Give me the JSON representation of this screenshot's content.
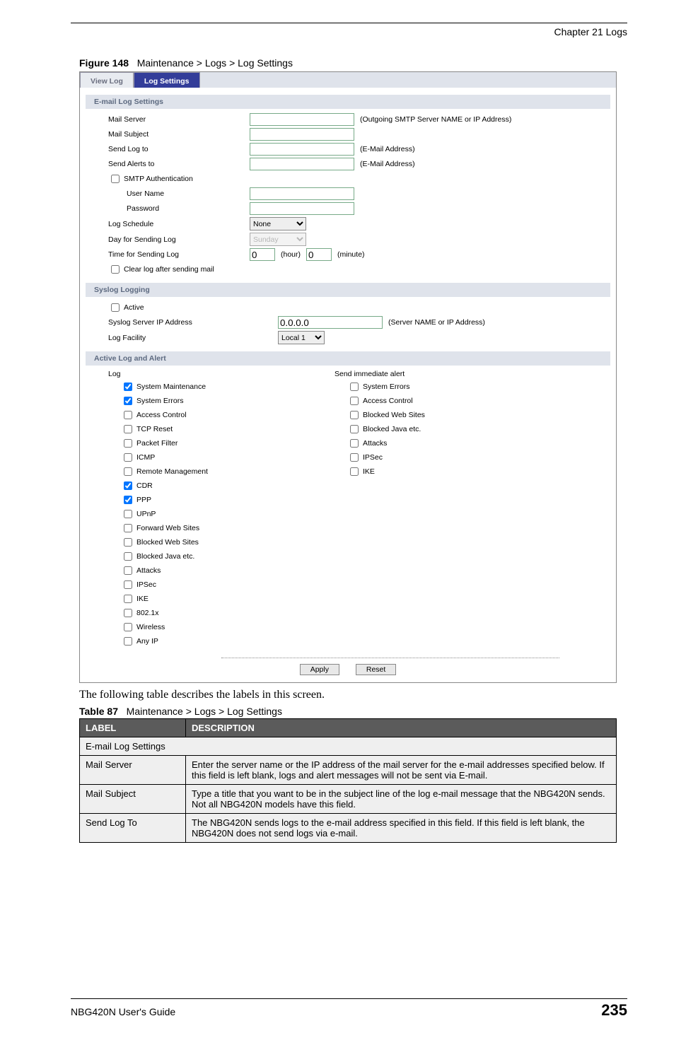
{
  "doc": {
    "chapter_header": "Chapter 21 Logs",
    "footer_guide": "NBG420N User's Guide",
    "page_number": "235"
  },
  "figure": {
    "caption_prefix": "Figure 148",
    "caption_text": "Maintenance > Logs > Log Settings"
  },
  "tabs": {
    "view_log": "View Log",
    "log_settings": "Log Settings"
  },
  "sections": {
    "email": "E-mail Log Settings",
    "syslog": "Syslog Logging",
    "active": "Active Log and Alert"
  },
  "email": {
    "mail_server_label": "Mail Server",
    "mail_server_hint": "(Outgoing SMTP Server NAME or IP Address)",
    "mail_subject_label": "Mail Subject",
    "send_log_to_label": "Send Log to",
    "send_log_to_hint": "(E-Mail Address)",
    "send_alerts_to_label": "Send Alerts to",
    "send_alerts_to_hint": "(E-Mail Address)",
    "smtp_auth_label": "SMTP Authentication",
    "user_name_label": "User Name",
    "password_label": "Password",
    "log_schedule_label": "Log Schedule",
    "log_schedule_value": "None",
    "day_sending_label": "Day for Sending Log",
    "day_sending_value": "Sunday",
    "time_sending_label": "Time for Sending Log",
    "hour_value": "0",
    "hour_suffix": "(hour)",
    "minute_value": "0",
    "minute_suffix": "(minute)",
    "clear_log_label": "Clear log after sending mail"
  },
  "syslog": {
    "active_label": "Active",
    "server_ip_label": "Syslog Server IP Address",
    "server_ip_value": "0.0.0.0",
    "server_ip_hint": "(Server NAME or IP Address)",
    "facility_label": "Log Facility",
    "facility_value": "Local 1"
  },
  "active_alert": {
    "log_header": "Log",
    "alert_header": "Send immediate alert",
    "log_items": [
      {
        "label": "System Maintenance",
        "checked": true
      },
      {
        "label": "System Errors",
        "checked": true
      },
      {
        "label": "Access Control",
        "checked": false
      },
      {
        "label": "TCP Reset",
        "checked": false
      },
      {
        "label": "Packet Filter",
        "checked": false
      },
      {
        "label": "ICMP",
        "checked": false
      },
      {
        "label": "Remote Management",
        "checked": false
      },
      {
        "label": "CDR",
        "checked": true
      },
      {
        "label": "PPP",
        "checked": true
      },
      {
        "label": "UPnP",
        "checked": false
      },
      {
        "label": "Forward Web Sites",
        "checked": false
      },
      {
        "label": "Blocked Web Sites",
        "checked": false
      },
      {
        "label": "Blocked Java etc.",
        "checked": false
      },
      {
        "label": "Attacks",
        "checked": false
      },
      {
        "label": "IPSec",
        "checked": false
      },
      {
        "label": "IKE",
        "checked": false
      },
      {
        "label": "802.1x",
        "checked": false
      },
      {
        "label": "Wireless",
        "checked": false
      },
      {
        "label": "Any IP",
        "checked": false
      }
    ],
    "alert_items": [
      {
        "label": "System Errors",
        "checked": false
      },
      {
        "label": "Access Control",
        "checked": false
      },
      {
        "label": "Blocked Web Sites",
        "checked": false
      },
      {
        "label": "Blocked Java etc.",
        "checked": false
      },
      {
        "label": "Attacks",
        "checked": false
      },
      {
        "label": "IPSec",
        "checked": false
      },
      {
        "label": "IKE",
        "checked": false
      }
    ]
  },
  "buttons": {
    "apply": "Apply",
    "reset": "Reset"
  },
  "body_text": "The following table describes the labels in this screen.",
  "table": {
    "caption_prefix": "Table 87",
    "caption_text": "Maintenance > Logs > Log Settings",
    "th_label": "LABEL",
    "th_desc": "DESCRIPTION",
    "section_row": "E-mail Log Settings",
    "rows": [
      {
        "label": "Mail Server",
        "desc": "Enter the server name or the IP address of the mail server for the e-mail addresses specified below. If this field is left blank, logs and alert messages will not be sent via E-mail."
      },
      {
        "label": "Mail Subject",
        "desc": "Type a title that you want to be in the subject line of the log e-mail message that the NBG420N sends. Not all NBG420N models have this field."
      },
      {
        "label": "Send Log To",
        "desc": "The NBG420N sends logs to the e-mail address specified in this field. If this field is left blank, the NBG420N does not send logs via e-mail."
      }
    ]
  }
}
